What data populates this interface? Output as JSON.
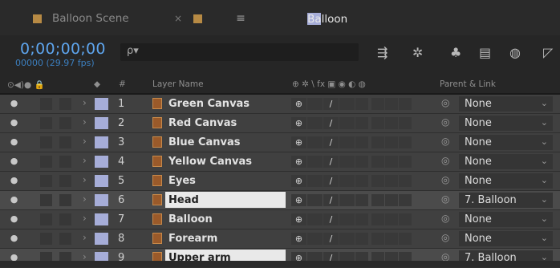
{
  "tabs": [
    {
      "label": "Balloon Scene",
      "active": false
    },
    {
      "label": "Balloon",
      "active": true,
      "close": "×",
      "menu": "≡"
    }
  ],
  "time": {
    "timecode": "0;00;00;00",
    "frames_fps": "00000 (29.97 fps)"
  },
  "search": {
    "icon": "ρ▾",
    "placeholder": ""
  },
  "columns": {
    "av_icons": "⊙◀)● 🔒",
    "label_icon": "◆",
    "number": "#",
    "layer_name": "Layer Name",
    "switches": "⊕ ✲ \\ fx ▣ ◉ ◐ ◍",
    "parent": "Parent & Link"
  },
  "layers": [
    {
      "num": "1",
      "name": "Green Canvas",
      "parent": "None",
      "selected": false
    },
    {
      "num": "2",
      "name": "Red Canvas",
      "parent": "None",
      "selected": false
    },
    {
      "num": "3",
      "name": "Blue Canvas",
      "parent": "None",
      "selected": false
    },
    {
      "num": "4",
      "name": "Yellow Canvas",
      "parent": "None",
      "selected": false
    },
    {
      "num": "5",
      "name": "Eyes",
      "parent": "None",
      "selected": false
    },
    {
      "num": "6",
      "name": "Head",
      "parent": "7. Balloon",
      "selected": true
    },
    {
      "num": "7",
      "name": "Balloon",
      "parent": "None",
      "selected": false
    },
    {
      "num": "8",
      "name": "Forearm",
      "parent": "None",
      "selected": false
    },
    {
      "num": "9",
      "name": "Upper arm",
      "parent": "7. Balloon",
      "selected": true
    }
  ],
  "colors": {
    "timecode": "#5ea5ee",
    "label_swatch": "#a6add8",
    "tab_swatch": "#b78a44"
  }
}
